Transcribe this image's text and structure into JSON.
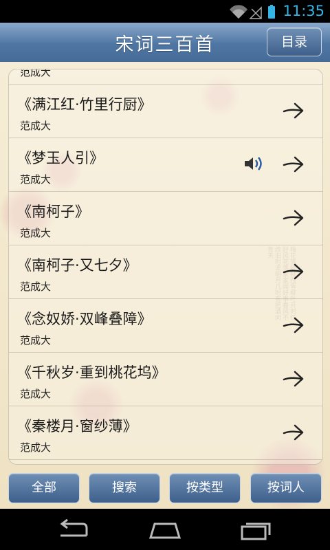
{
  "status": {
    "time": "11:35"
  },
  "header": {
    "title": "宋词三百首",
    "menu_label": "目录"
  },
  "list": {
    "items": [
      {
        "title": "",
        "author": "范成大",
        "audio": false
      },
      {
        "title": "《满江红·竹里行厨》",
        "author": "范成大",
        "audio": false
      },
      {
        "title": "《梦玉人引》",
        "author": "范成大",
        "audio": true
      },
      {
        "title": "《南柯子》",
        "author": "范成大",
        "audio": false
      },
      {
        "title": "《南柯子·又七夕》",
        "author": "范成大",
        "audio": false
      },
      {
        "title": "《念奴娇·双峰叠障》",
        "author": "范成大",
        "audio": false
      },
      {
        "title": "《千秋岁·重到桃花坞》",
        "author": "范成大",
        "audio": false
      },
      {
        "title": "《秦楼月·窗纱薄》",
        "author": "范成大",
        "audio": false
      }
    ]
  },
  "tabs": {
    "all": "全部",
    "search": "搜索",
    "by_type": "按类型",
    "by_author": "按词人"
  },
  "decor": {
    "calligraphy": "梅花落处疑残雪柳叶开时任好风花落家家闻好事春风不改旧时波明月几时有把酒问青天"
  },
  "colors": {
    "accent": "#4f76a3",
    "clock": "#34b5e5"
  }
}
